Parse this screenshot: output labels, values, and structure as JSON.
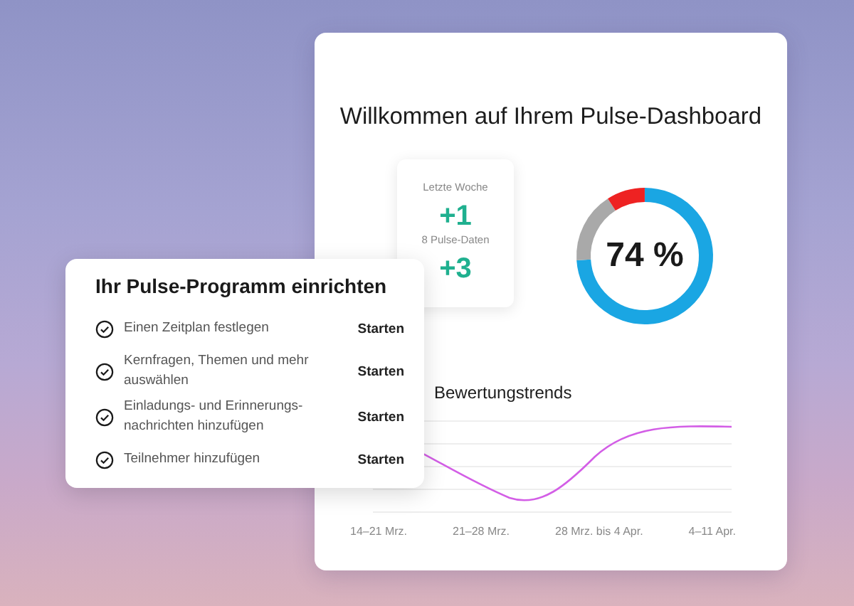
{
  "dashboard": {
    "title": "Willkommen auf Ihrem Pulse-Dashboard",
    "stats": {
      "period": "Letzte Woche",
      "first_value": "+1",
      "caption": "8 Pulse-Daten",
      "second_value": "+3"
    },
    "donut": {
      "label": "74 %"
    },
    "trend": {
      "title": "Bewertungstrends",
      "x_labels": [
        "14–21 Mrz.",
        "21–28 Mrz.",
        "28 Mrz. bis 4 Apr.",
        "4–11 Apr."
      ]
    }
  },
  "setup": {
    "title": "Ihr Pulse-Programm einrichten",
    "tasks": [
      {
        "label": "Einen Zeitplan festlegen",
        "action": "Starten"
      },
      {
        "label": "Kernfragen, Themen und mehr auswählen",
        "action": "Starten"
      },
      {
        "label": "Einladungs- und Erinnerungs-nachrichten hinzufügen",
        "action": "Starten"
      },
      {
        "label": "Teilnehmer hinzufügen",
        "action": "Starten"
      }
    ]
  }
}
